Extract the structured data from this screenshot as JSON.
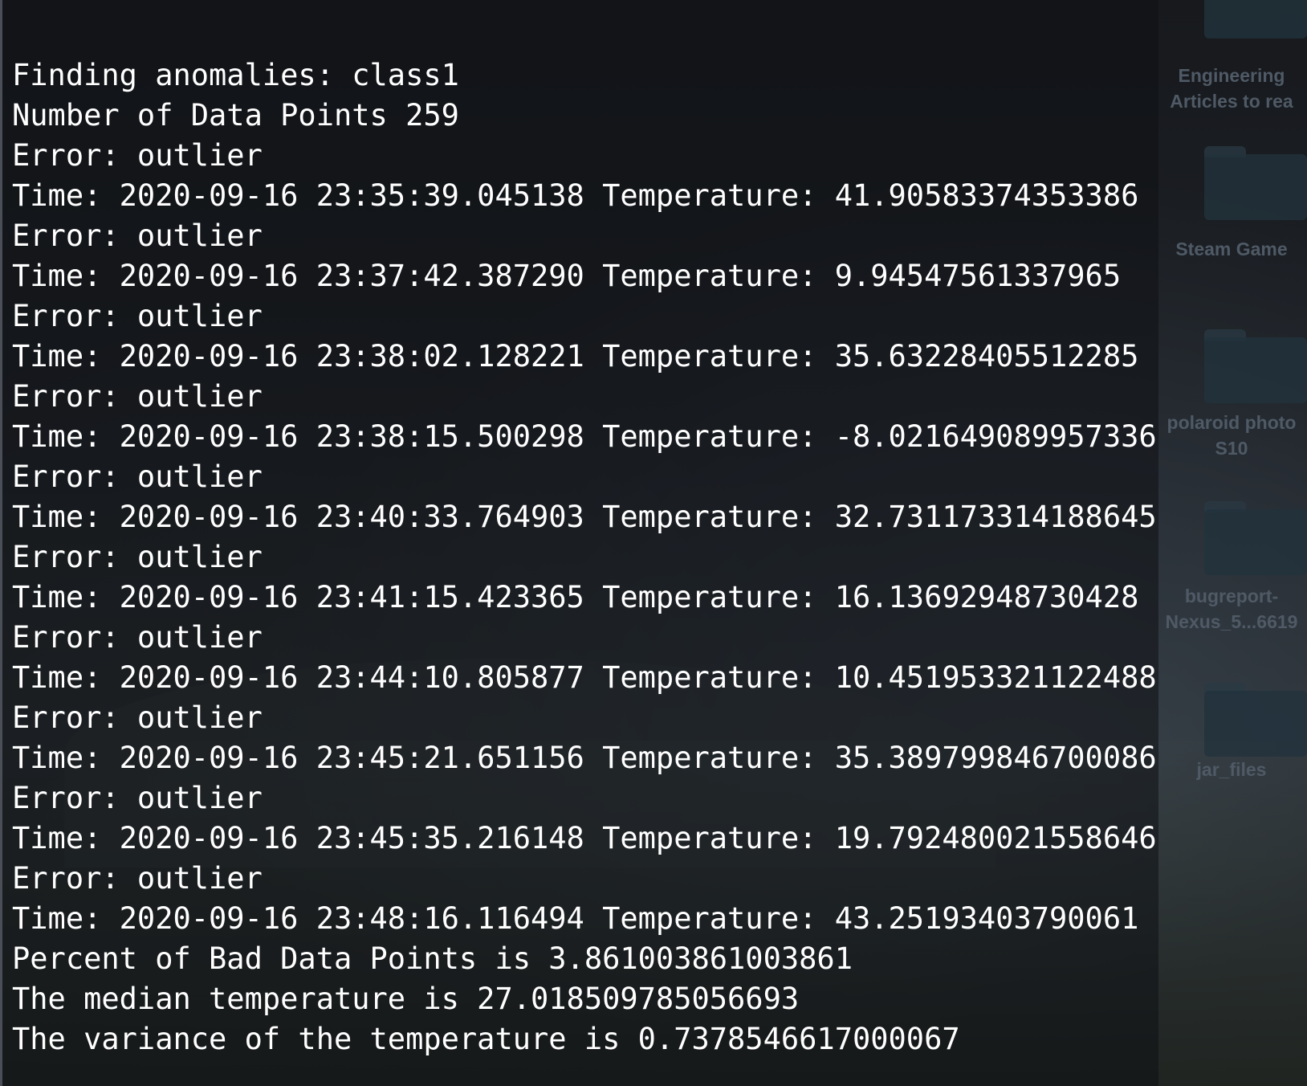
{
  "terminal": {
    "lines": [
      "Finding anomalies: class1",
      "Number of Data Points 259",
      "Error: outlier",
      "Time: 2020-09-16 23:35:39.045138 Temperature: 41.90583374353386",
      "Error: outlier",
      "Time: 2020-09-16 23:37:42.387290 Temperature: 9.94547561337965",
      "Error: outlier",
      "Time: 2020-09-16 23:38:02.128221 Temperature: 35.63228405512285",
      "Error: outlier",
      "Time: 2020-09-16 23:38:15.500298 Temperature: -8.021649089957336",
      "Error: outlier",
      "Time: 2020-09-16 23:40:33.764903 Temperature: 32.731173314188645",
      "Error: outlier",
      "Time: 2020-09-16 23:41:15.423365 Temperature: 16.13692948730428",
      "Error: outlier",
      "Time: 2020-09-16 23:44:10.805877 Temperature: 10.451953321122488",
      "Error: outlier",
      "Time: 2020-09-16 23:45:21.651156 Temperature: 35.389799846700086",
      "Error: outlier",
      "Time: 2020-09-16 23:45:35.216148 Temperature: 19.792480021558646",
      "Error: outlier",
      "Time: 2020-09-16 23:48:16.116494 Temperature: 43.25193403790061",
      "Percent of Bad Data Points is 3.861003861003861",
      "The median temperature is 27.018509785056693",
      "The variance of the temperature is 0.7378546617000067"
    ]
  },
  "desktop": {
    "icons": [
      {
        "label_line1": "Engineering",
        "label_line2": "Articles to rea",
        "icon": "folder-icon"
      },
      {
        "label_line1": "Steam Game",
        "label_line2": "",
        "icon": "folder-icon"
      },
      {
        "label_line1": "polaroid photo",
        "label_line2": "S10",
        "icon": "folder-icon"
      },
      {
        "label_line1": "bugreport-",
        "label_line2": "Nexus_5...6619",
        "icon": "folder-icon"
      },
      {
        "label_line1": "jar_files",
        "label_line2": "",
        "icon": "folder-icon"
      }
    ]
  }
}
